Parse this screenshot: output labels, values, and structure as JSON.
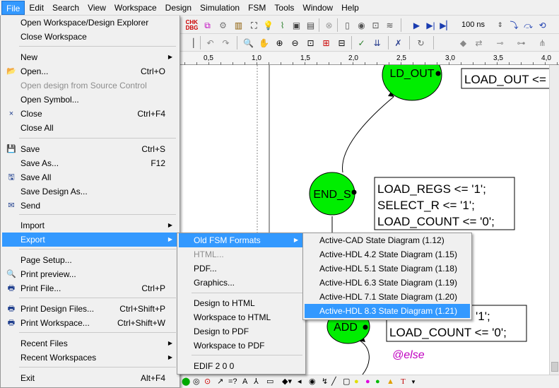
{
  "menubar": [
    "File",
    "Edit",
    "Search",
    "View",
    "Workspace",
    "Design",
    "Simulation",
    "FSM",
    "Tools",
    "Window",
    "Help"
  ],
  "toolbar": {
    "sim_time": "100 ns"
  },
  "ruler": [
    "0,5",
    "1,0",
    "1,5",
    "2,0",
    "2,5",
    "3,0",
    "3,5",
    "4,0"
  ],
  "file_menu": {
    "items": [
      {
        "label": "Open Workspace/Design Explorer",
        "shortcut": "",
        "icon": "",
        "disabled": false,
        "submenu": false
      },
      {
        "label": "Close Workspace",
        "shortcut": "",
        "icon": "",
        "disabled": false,
        "submenu": false
      },
      {
        "label": "New",
        "shortcut": "",
        "icon": "",
        "disabled": false,
        "submenu": true
      },
      {
        "label": "Open...",
        "shortcut": "Ctrl+O",
        "icon": "open-folder-icon",
        "disabled": false,
        "submenu": false
      },
      {
        "label": "Open design from Source Control",
        "shortcut": "",
        "icon": "",
        "disabled": true,
        "submenu": false
      },
      {
        "label": "Open Symbol...",
        "shortcut": "",
        "icon": "",
        "disabled": false,
        "submenu": false
      },
      {
        "label": "Close",
        "shortcut": "Ctrl+F4",
        "icon": "close-x-icon",
        "disabled": false,
        "submenu": false
      },
      {
        "label": "Close All",
        "shortcut": "",
        "icon": "",
        "disabled": false,
        "submenu": false
      },
      {
        "label": "Save",
        "shortcut": "Ctrl+S",
        "icon": "floppy-disk-icon",
        "disabled": false,
        "submenu": false
      },
      {
        "label": "Save As...",
        "shortcut": "F12",
        "icon": "",
        "disabled": false,
        "submenu": false
      },
      {
        "label": "Save All",
        "shortcut": "",
        "icon": "save-all-icon",
        "disabled": false,
        "submenu": false
      },
      {
        "label": "Save Design As...",
        "shortcut": "",
        "icon": "",
        "disabled": false,
        "submenu": false
      },
      {
        "label": "Send",
        "shortcut": "",
        "icon": "send-mail-icon",
        "disabled": false,
        "submenu": false
      },
      {
        "label": "Import",
        "shortcut": "",
        "icon": "",
        "disabled": false,
        "submenu": true
      },
      {
        "label": "Export",
        "shortcut": "",
        "icon": "",
        "disabled": false,
        "submenu": true
      },
      {
        "label": "Page Setup...",
        "shortcut": "",
        "icon": "",
        "disabled": false,
        "submenu": false
      },
      {
        "label": "Print preview...",
        "shortcut": "",
        "icon": "print-preview-icon",
        "disabled": false,
        "submenu": false
      },
      {
        "label": "Print File...",
        "shortcut": "Ctrl+P",
        "icon": "printer-icon",
        "disabled": false,
        "submenu": false
      },
      {
        "label": "Print Design Files...",
        "shortcut": "Ctrl+Shift+P",
        "icon": "print-design-icon",
        "disabled": false,
        "submenu": false
      },
      {
        "label": "Print Workspace...",
        "shortcut": "Ctrl+Shift+W",
        "icon": "print-workspace-icon",
        "disabled": false,
        "submenu": false
      },
      {
        "label": "Recent Files",
        "shortcut": "",
        "icon": "",
        "disabled": false,
        "submenu": true
      },
      {
        "label": "Recent Workspaces",
        "shortcut": "",
        "icon": "",
        "disabled": false,
        "submenu": true
      },
      {
        "label": "Exit",
        "shortcut": "Alt+F4",
        "icon": "",
        "disabled": false,
        "submenu": false
      }
    ]
  },
  "export_menu": {
    "items": [
      {
        "label": "Old FSM Formats",
        "disabled": false,
        "submenu": true
      },
      {
        "label": "HTML...",
        "disabled": true,
        "submenu": false
      },
      {
        "label": "PDF...",
        "disabled": false,
        "submenu": false
      },
      {
        "label": "Graphics...",
        "disabled": false,
        "submenu": false
      },
      {
        "label": "Design to HTML",
        "disabled": false,
        "submenu": false
      },
      {
        "label": "Workspace to HTML",
        "disabled": false,
        "submenu": false
      },
      {
        "label": "Design to PDF",
        "disabled": false,
        "submenu": false
      },
      {
        "label": "Workspace to PDF",
        "disabled": false,
        "submenu": false
      },
      {
        "label": "EDIF 2 0 0",
        "disabled": false,
        "submenu": false
      }
    ]
  },
  "oldfsm_menu": {
    "items": [
      "Active-CAD State Diagram (1.12)",
      "Active-HDL 4.2 State Diagram (1.15)",
      "Active-HDL 5.1 State Diagram (1.18)",
      "Active-HDL 6.3 State Diagram (1.19)",
      "Active-HDL 7.1 State Diagram (1.20)",
      "Active-HDL 8.3 State Diagram (1.21)"
    ]
  },
  "diagram": {
    "states": [
      {
        "name": "LD_OUT",
        "color": "#00ee00"
      },
      {
        "name": "END_S",
        "color": "#00ee00"
      },
      {
        "name": "ADD",
        "color": "#00ee00"
      }
    ],
    "actions": {
      "ld_out": [
        "LOAD_OUT <="
      ],
      "end_s": [
        "LOAD_REGS <= '1';",
        "SELECT_R <= '1';",
        "LOAD_COUNT <= '0';"
      ],
      "add": [
        "'1';",
        "LOAD_COUNT <= '0';"
      ]
    },
    "else_label": "@else"
  },
  "colors": {
    "highlight": "#3399ff",
    "state_fill": "#00ee00",
    "else_text": "#c000c0"
  }
}
